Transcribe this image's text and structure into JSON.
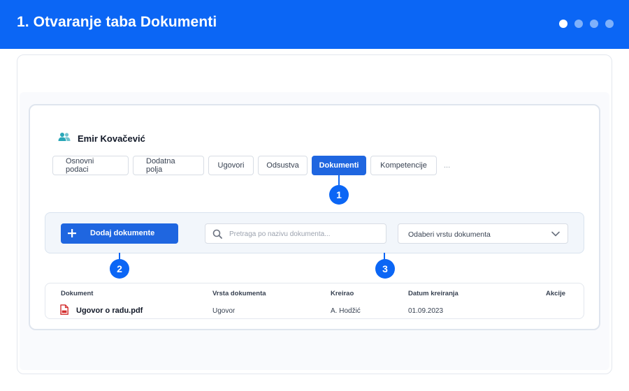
{
  "header": {
    "title": "1. Otvaranje taba Dokumenti",
    "steps_total": 4,
    "active_step": 1
  },
  "user": {
    "name": "Emir Kovačević",
    "icon": "users-icon"
  },
  "tabs": [
    {
      "label": "Osnovni podaci",
      "active": false
    },
    {
      "label": "Dodatna polja",
      "active": false
    },
    {
      "label": "Ugovori",
      "active": false
    },
    {
      "label": "Odsustva",
      "active": false
    },
    {
      "label": "Dokumenti",
      "active": true
    },
    {
      "label": "Kompetencije",
      "active": false
    }
  ],
  "tabs_more": "...",
  "markers": [
    "1",
    "2",
    "3"
  ],
  "toolbar": {
    "add_button_label": "Dodaj dokumente",
    "search_placeholder": "Pretraga po nazivu dokumenta...",
    "search_value": "",
    "type_select_label": "Odaberi vrstu dokumenta"
  },
  "table": {
    "headers": [
      "Dokument",
      "Vrsta dokumenta",
      "Kreirao",
      "Datum kreiranja",
      "Akcije"
    ],
    "rows": [
      {
        "document": "Ugovor o radu.pdf",
        "type": "Ugovor",
        "created_by": "A. Hodžić",
        "created_date": "01.09.2023"
      }
    ]
  },
  "colors": {
    "brand": "#0b66f5",
    "active_tab": "#1f66e0",
    "pdf": "#d32f2f",
    "user_icon": "#2aa7b8"
  }
}
